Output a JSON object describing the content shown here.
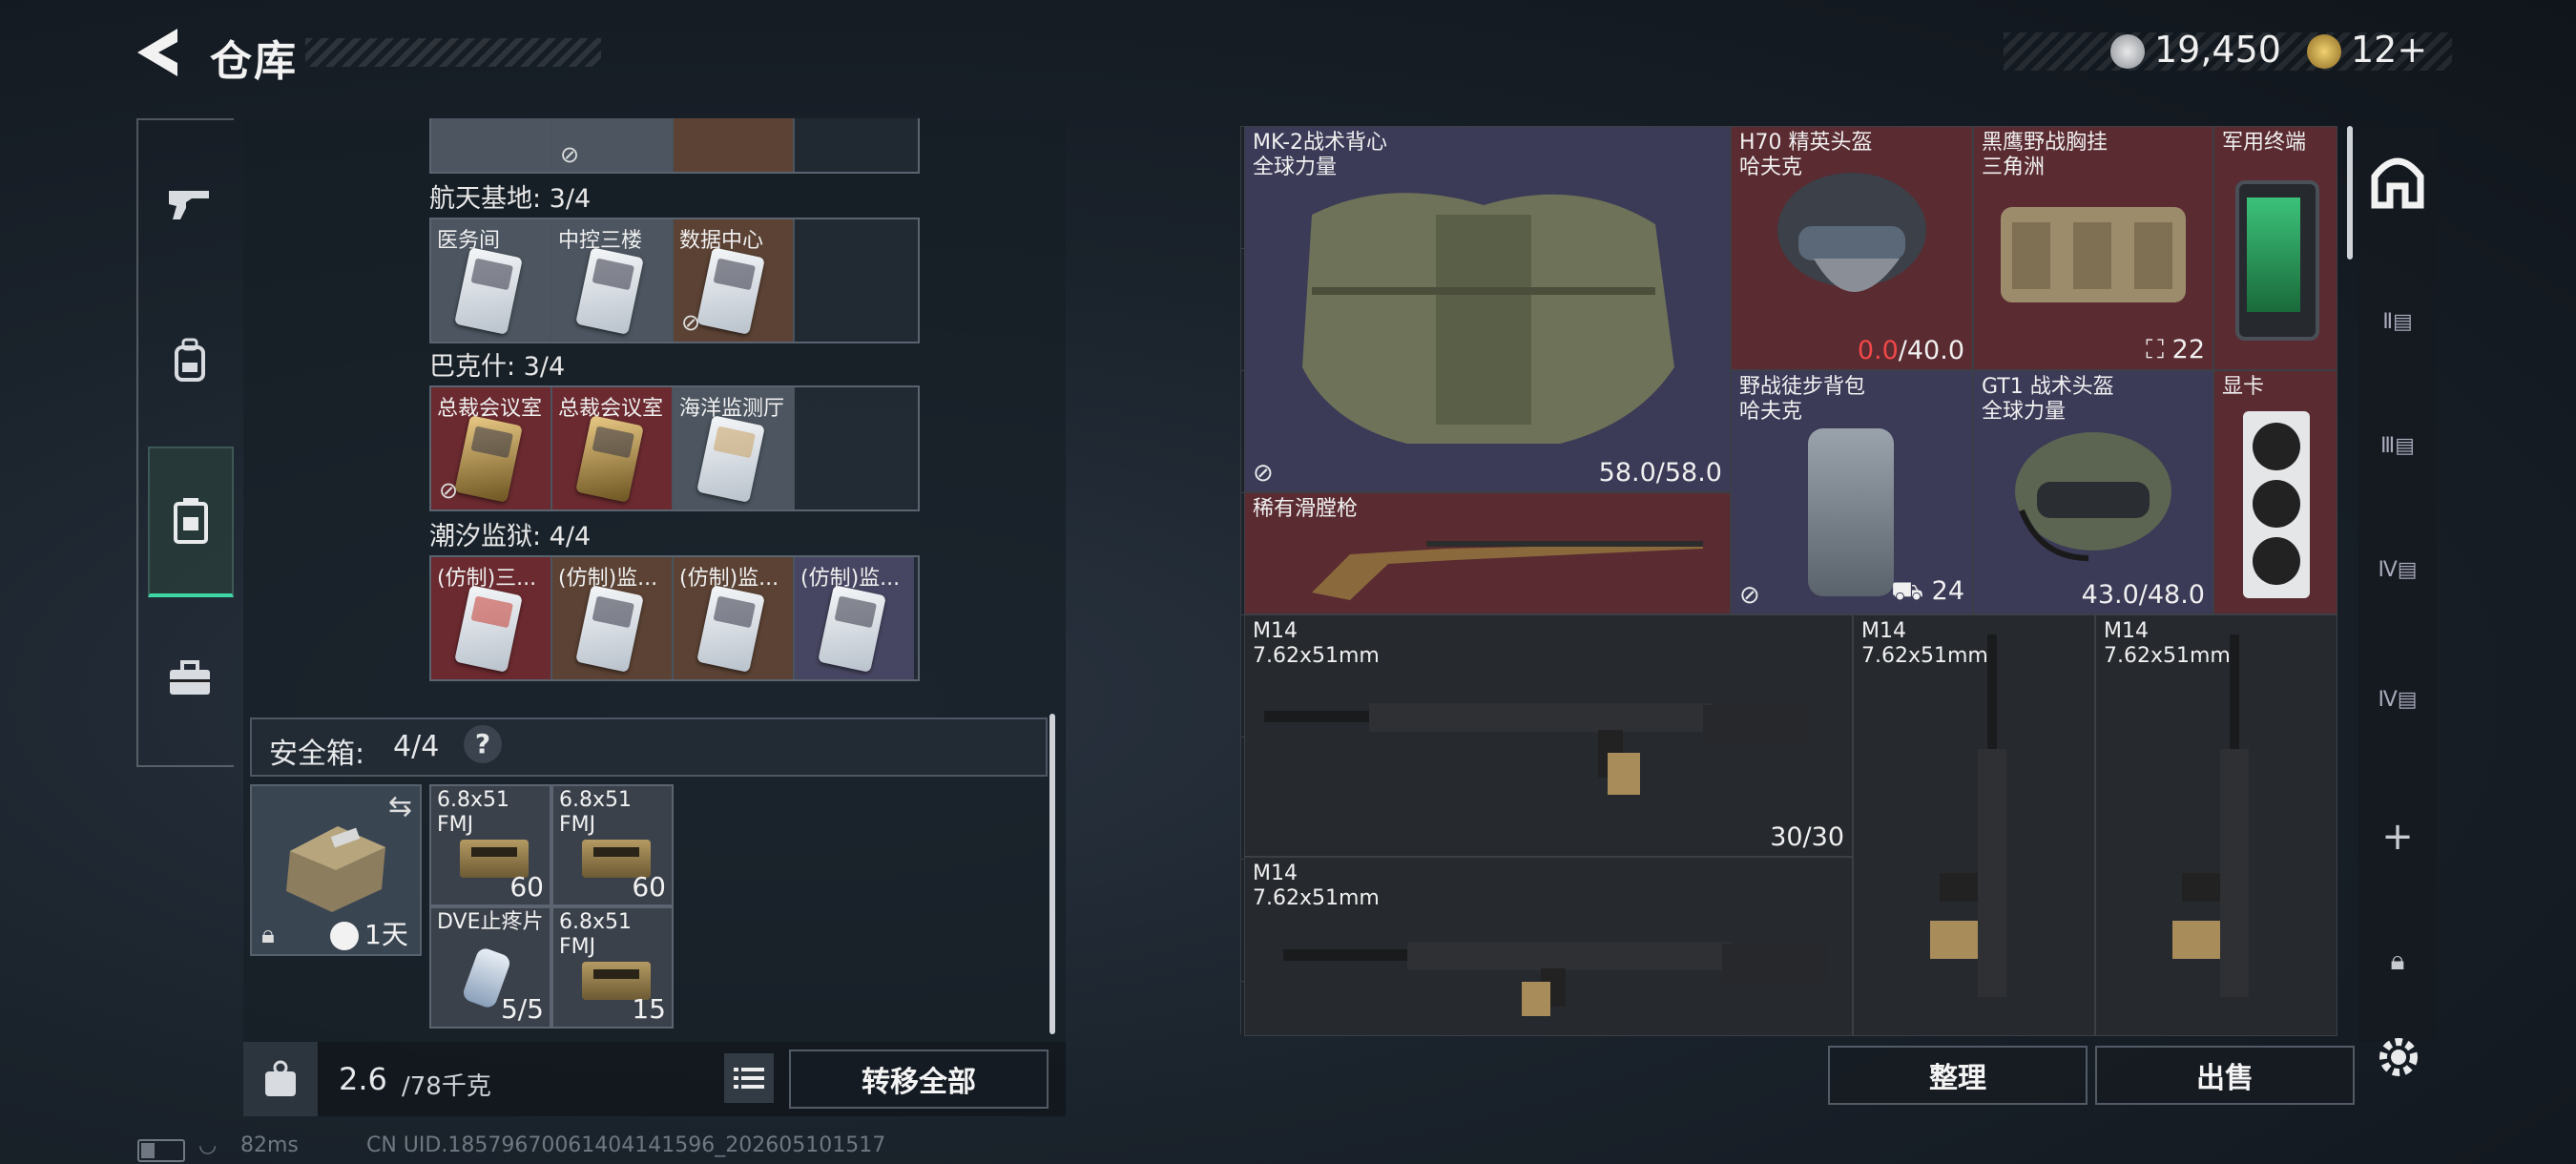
{
  "header": {
    "title": "仓库",
    "currency1": "19,450",
    "currency2": "12+"
  },
  "left_groups": [
    {
      "title": "航天基地: 3/4",
      "cards": [
        "医务间",
        "中控三楼",
        "数据中心",
        ""
      ]
    },
    {
      "title": "巴克什: 3/4",
      "cards": [
        "总裁会议室",
        "总裁会议室",
        "海洋监测厅",
        ""
      ]
    },
    {
      "title": "潮汐监狱: 4/4",
      "cards": [
        "(仿制)三...",
        "(仿制)监...",
        "(仿制)监...",
        "(仿制)监..."
      ]
    }
  ],
  "safe": {
    "title": "安全箱:",
    "count": "4/4",
    "help": "?",
    "timer": "1天",
    "slots": [
      {
        "label": "6.8x51\nFMJ",
        "count": "60"
      },
      {
        "label": "6.8x51\nFMJ",
        "count": "60"
      },
      {
        "label": "DVE止疼片",
        "count": "5/5"
      },
      {
        "label": "6.8x51\nFMJ",
        "count": "15"
      }
    ]
  },
  "weight": {
    "current": "2.6",
    "max": "/78千克"
  },
  "buttons": {
    "transfer_all": "转移全部",
    "sort": "整理",
    "sell": "出售"
  },
  "items": {
    "vest": {
      "name": "MK-2战术背心",
      "brand": "全球力量",
      "value": "58.0/58.0"
    },
    "helmet1": {
      "name": "H70 精英头盔",
      "brand": "哈夫克",
      "value_red": "0.0",
      "value": "/40.0"
    },
    "rig": {
      "name": "黑鹰野战胸挂",
      "brand": "三角洲",
      "value": "22"
    },
    "terminal": {
      "name": "军用终端"
    },
    "shotgun": {
      "name": "稀有滑膛枪"
    },
    "backpack": {
      "name": "野战徒步背包",
      "brand": "哈夫克",
      "value": "24"
    },
    "helmet2": {
      "name": "GT1 战术头盔",
      "brand": "全球力量",
      "value": "43.0/48.0"
    },
    "gpu": {
      "name": "显卡"
    },
    "m14_a": {
      "name": "M14",
      "caliber": "7.62x51mm",
      "value": "30/30"
    },
    "m14_b": {
      "name": "M14",
      "caliber": "7.62x51mm"
    },
    "m14_c": {
      "name": "M14",
      "caliber": "7.62x51mm"
    },
    "m14_d": {
      "name": "M14",
      "caliber": "7.62x51mm"
    }
  },
  "status": {
    "ping": "82ms",
    "uid": "CN UID.18579670061404141596_202605101517"
  },
  "colors": {
    "accent": "#3fd6a6",
    "red_value": "#f04848",
    "rare_purple": "#3b3a57",
    "rare_red": "#5a2b31"
  }
}
